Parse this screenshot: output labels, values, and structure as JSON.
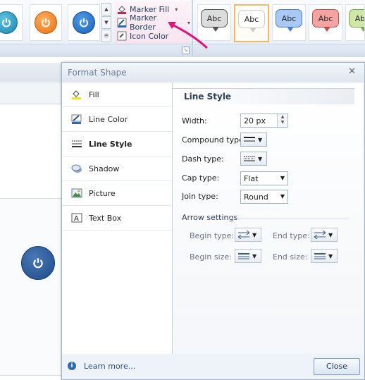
{
  "ribbon": {
    "marker_menu": {
      "fill": "Marker Fill",
      "border": "Marker Border",
      "icon_color": "Icon Color"
    },
    "power_tiles": [
      "teal",
      "orange",
      "blue"
    ],
    "styles": [
      {
        "label": "Abc",
        "color": "#dcdcdc"
      },
      {
        "label": "Abc",
        "color": "#ffffff"
      },
      {
        "label": "Abc",
        "color": "#a8c8f5"
      },
      {
        "label": "Abc",
        "color": "#f5a3a3"
      },
      {
        "label": "Abc",
        "color": "#cfe8a8"
      }
    ]
  },
  "dialog": {
    "title": "Format Shape",
    "nav": [
      "Fill",
      "Line Color",
      "Line Style",
      "Shadow",
      "Picture",
      "Text Box"
    ],
    "selected_nav": "Line Style",
    "panel_title": "Line Style",
    "width_label": "Width:",
    "width_value": "20 px",
    "compound_label": "Compound type:",
    "dash_label": "Dash type:",
    "cap_label": "Cap type:",
    "cap_value": "Flat",
    "join_label": "Join type:",
    "join_value": "Round",
    "arrow_settings": "Arrow settings",
    "begin_type": "Begin type:",
    "end_type": "End type:",
    "begin_size": "Begin size:",
    "end_size": "End size:",
    "learn_more": "Learn more...",
    "close": "Close"
  },
  "colors": {
    "accent_blue": "#2e6ab1",
    "arrow_pink": "#e0157a"
  }
}
